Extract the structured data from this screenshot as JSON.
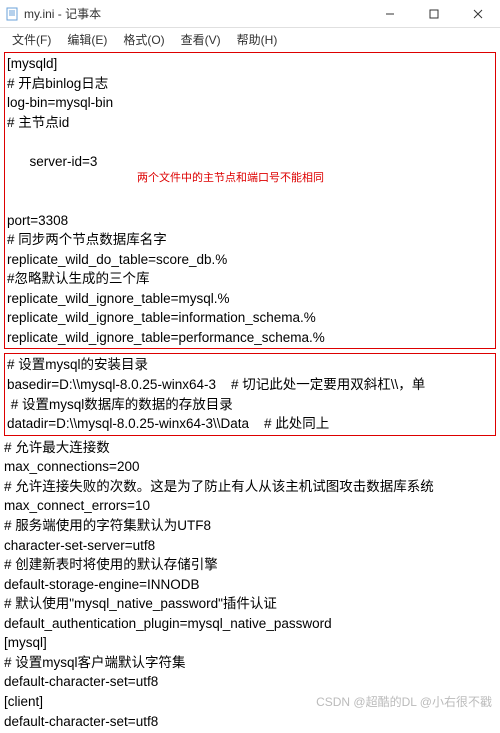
{
  "window": {
    "title": "my.ini - 记事本"
  },
  "menu": {
    "file": "文件(F)",
    "edit": "编辑(E)",
    "format": "格式(O)",
    "view": "查看(V)",
    "help": "帮助(H)"
  },
  "box1": {
    "l0": "[mysqld]",
    "l1": "# 开启binlog日志",
    "l2": "log-bin=mysql-bin",
    "l3": "# 主节点id",
    "l4": "server-id=3",
    "l4note": "两个文件中的主节点和端口号不能相同",
    "l5": "port=3308",
    "l6": "# 同步两个节点数据库名字",
    "l7": "replicate_wild_do_table=score_db.%",
    "l8": "#忽略默认生成的三个库",
    "l9": "replicate_wild_ignore_table=mysql.%",
    "l10": "replicate_wild_ignore_table=information_schema.%",
    "l11": "replicate_wild_ignore_table=performance_schema.%"
  },
  "box2": {
    "l0": "# 设置mysql的安装目录",
    "l1": "basedir=D:\\\\mysql-8.0.25-winx64-3    # 切记此处一定要用双斜杠\\\\，单",
    "l2": " # 设置mysql数据库的数据的存放目录",
    "l3": "datadir=D:\\\\mysql-8.0.25-winx64-3\\\\Data    # 此处同上"
  },
  "rest": {
    "l0": "# 允许最大连接数",
    "l1": "max_connections=200",
    "l2": "# 允许连接失败的次数。这是为了防止有人从该主机试图攻击数据库系统",
    "l3": "max_connect_errors=10",
    "l4": "# 服务端使用的字符集默认为UTF8",
    "l5": "character-set-server=utf8",
    "l6": "# 创建新表时将使用的默认存储引擎",
    "l7": "default-storage-engine=INNODB",
    "l8": "# 默认使用\"mysql_native_password\"插件认证",
    "l9": "default_authentication_plugin=mysql_native_password",
    "l10": "[mysql]",
    "l11": "# 设置mysql客户端默认字符集",
    "l12": "default-character-set=utf8",
    "l13": "[client]",
    "l14": "default-character-set=utf8"
  },
  "watermark": "CSDN @超酷的DL @小右很不戳"
}
